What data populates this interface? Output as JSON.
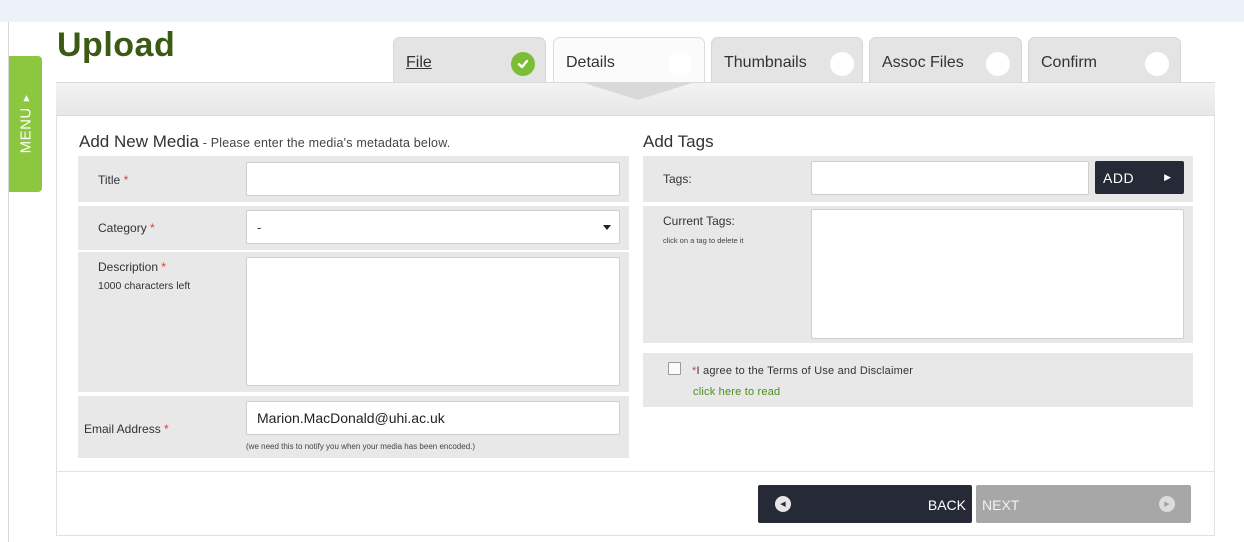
{
  "page": {
    "title": "Upload"
  },
  "menu": {
    "label": "MENU"
  },
  "tabs": [
    {
      "label": "File",
      "status": "complete"
    },
    {
      "label": "Details",
      "status": "current"
    },
    {
      "label": "Thumbnails",
      "status": "pending"
    },
    {
      "label": "Assoc Files",
      "status": "pending"
    },
    {
      "label": "Confirm",
      "status": "pending"
    }
  ],
  "media_form": {
    "heading": "Add New Media",
    "subheading": " - Please enter the media's metadata below.",
    "required_marker": "*",
    "title": {
      "label": "Title ",
      "value": ""
    },
    "category": {
      "label": "Category ",
      "value": "-"
    },
    "description": {
      "label": "Description ",
      "hint": "1000 characters left",
      "value": ""
    },
    "email": {
      "label": "Email Address ",
      "value": "Marion.MacDonald@uhi.ac.uk",
      "hint": "(we need this to notify you when your media has been encoded.)"
    }
  },
  "tags_form": {
    "heading": "Add Tags",
    "tags_label": "Tags:",
    "tags_value": "",
    "add_button": "ADD",
    "current_tags_label": "Current Tags:",
    "current_tags_hint": "click on a tag to delete it",
    "current_tags_value": "",
    "terms_required_marker": "*",
    "terms_text": "I agree to the Terms of Use and Disclaimer",
    "terms_checked": false,
    "terms_link": "click here to read"
  },
  "navigation": {
    "back_label": "BACK",
    "next_label": "NEXT"
  },
  "colors": {
    "brand_green": "#8dc63f",
    "title_green": "#3c5a13",
    "link_green": "#4a8f1c",
    "required_red": "#e23b3b",
    "dark_button": "#252a36",
    "disabled_button": "#a7a7a7"
  },
  "icons": {
    "file_tab": "check-circle-icon",
    "pending_tab": "empty-circle-icon",
    "back": "arrow-left-circle-icon",
    "next": "arrow-right-circle-icon",
    "add": "triangle-right-icon"
  }
}
